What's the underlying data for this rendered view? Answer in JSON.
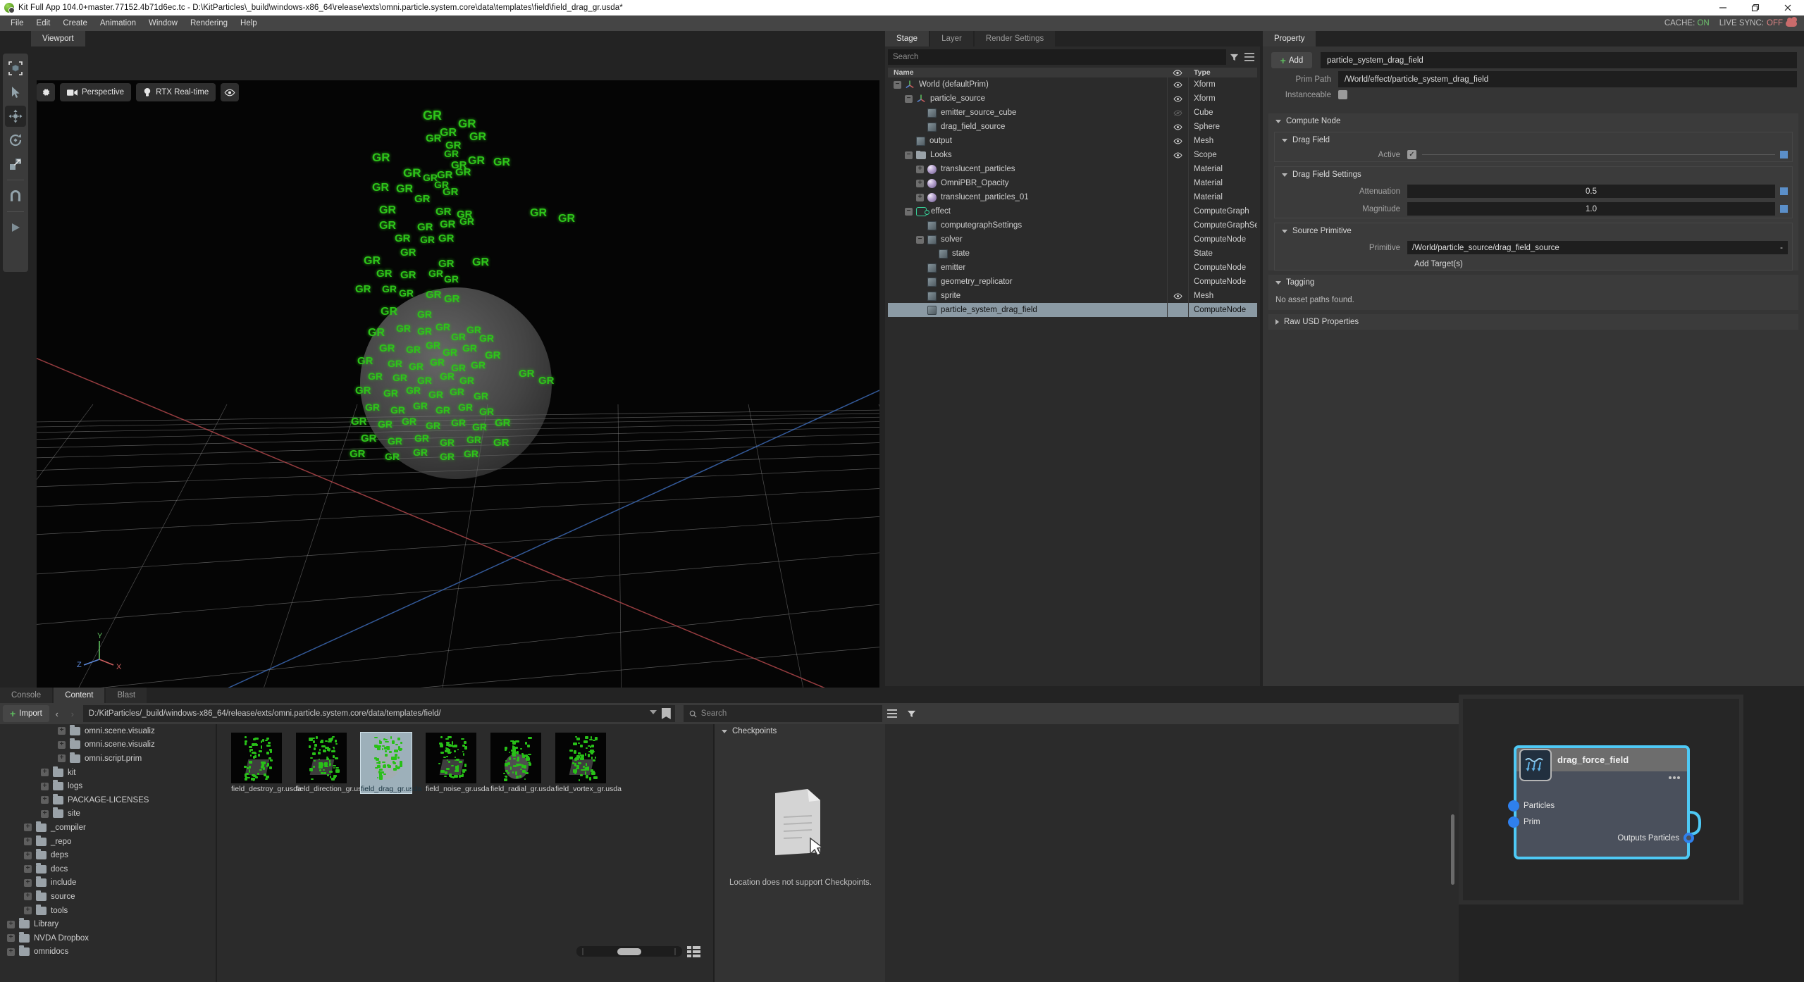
{
  "titlebar": {
    "title": "Kit Full App 104.0+master.77152.4b71d6ec.tc - D:\\KitParticles\\_build\\windows-x86_64\\release\\exts\\omni.particle.system.core\\data\\templates\\field\\field_drag_gr.usda*",
    "minimize": "minimize-icon",
    "maximize": "maximize-icon",
    "close": "close-icon"
  },
  "menubar": {
    "items": [
      "File",
      "Edit",
      "Create",
      "Animation",
      "Window",
      "Rendering",
      "Help"
    ],
    "cache_label": "CACHE:",
    "cache_value": "ON",
    "livesync_label": "LIVE SYNC:",
    "livesync_value": "OFF"
  },
  "viewport": {
    "tab": "Viewport",
    "toolbar": {
      "settings": "gear-icon",
      "camera": "Perspective",
      "renderer": "RTX Real-time",
      "visibility": "eye-icon"
    },
    "left_tools": [
      "select-bounds-tool",
      "pointer-select-tool",
      "move-tool",
      "rotate-tool",
      "scale-tool",
      "snap-tool",
      "play-tool"
    ],
    "axis": {
      "x": "X",
      "y": "Y",
      "z": "Z"
    },
    "particle_label": "GR"
  },
  "stage": {
    "tabs": [
      {
        "label": "Stage",
        "active": true
      },
      {
        "label": "Layer",
        "active": false
      },
      {
        "label": "Render Settings",
        "active": false
      }
    ],
    "search_placeholder": "Search",
    "columns": {
      "name": "Name",
      "eye": "eye-icon",
      "type": "Type"
    },
    "rows": [
      {
        "name": "World (defaultPrim)",
        "type": "Xform",
        "depth": 0,
        "icon": "xform",
        "expander": "minus",
        "eye": true
      },
      {
        "name": "particle_source",
        "type": "Xform",
        "depth": 1,
        "icon": "xform",
        "expander": "minus",
        "eye": true
      },
      {
        "name": "emitter_source_cube",
        "type": "Cube",
        "depth": 2,
        "icon": "cube",
        "expander": "none",
        "eye": "dim"
      },
      {
        "name": "drag_field_source",
        "type": "Sphere",
        "depth": 2,
        "icon": "cube",
        "expander": "none",
        "eye": true
      },
      {
        "name": "output",
        "type": "Mesh",
        "depth": 1,
        "icon": "cube",
        "expander": "none",
        "eye": true
      },
      {
        "name": "Looks",
        "type": "Scope",
        "depth": 1,
        "icon": "folder",
        "expander": "minus",
        "eye": true
      },
      {
        "name": "translucent_particles",
        "type": "Material",
        "depth": 2,
        "icon": "mat",
        "expander": "plus",
        "eye": false
      },
      {
        "name": "OmniPBR_Opacity",
        "type": "Material",
        "depth": 2,
        "icon": "mat",
        "expander": "plus",
        "eye": false
      },
      {
        "name": "translucent_particles_01",
        "type": "Material",
        "depth": 2,
        "icon": "mat",
        "expander": "plus",
        "eye": false
      },
      {
        "name": "effect",
        "type": "ComputeGraph",
        "depth": 1,
        "icon": "graph",
        "expander": "minus",
        "eye": false
      },
      {
        "name": "computegraphSettings",
        "type": "ComputeGraphSe",
        "depth": 2,
        "icon": "cube",
        "expander": "none",
        "eye": false
      },
      {
        "name": "solver",
        "type": "ComputeNode",
        "depth": 2,
        "icon": "cube",
        "expander": "minus",
        "eye": false
      },
      {
        "name": "state",
        "type": "State",
        "depth": 3,
        "icon": "cube",
        "expander": "none",
        "eye": false
      },
      {
        "name": "emitter",
        "type": "ComputeNode",
        "depth": 2,
        "icon": "cube",
        "expander": "none",
        "eye": false
      },
      {
        "name": "geometry_replicator",
        "type": "ComputeNode",
        "depth": 2,
        "icon": "cube",
        "expander": "none",
        "eye": false
      },
      {
        "name": "sprite",
        "type": "Mesh",
        "depth": 2,
        "icon": "cube",
        "expander": "none",
        "eye": true
      },
      {
        "name": "particle_system_drag_field",
        "type": "ComputeNode",
        "depth": 2,
        "icon": "cube",
        "expander": "none",
        "eye": false,
        "selected": true
      }
    ]
  },
  "property": {
    "tab": "Property",
    "add_label": "Add",
    "name_value": "particle_system_drag_field",
    "prim_path_label": "Prim Path",
    "prim_path_value": "/World/effect/particle_system_drag_field",
    "instanceable_label": "Instanceable",
    "compute_node_label": "Compute Node",
    "drag_field_label": "Drag Field",
    "active_label": "Active",
    "drag_field_settings_label": "Drag Field Settings",
    "attenuation_label": "Attenuation",
    "attenuation_value": "0.5",
    "magnitude_label": "Magnitude",
    "magnitude_value": "1.0",
    "source_primitive_label": "Source Primitive",
    "primitive_label": "Primitive",
    "primitive_value": "/World/particle_source/drag_field_source",
    "primitive_clear": "-",
    "add_targets_label": "Add Target(s)",
    "tagging_label": "Tagging",
    "no_asset_label": "No asset paths found.",
    "raw_usd_label": "Raw USD Properties"
  },
  "content": {
    "tabs": [
      {
        "label": "Console",
        "active": false
      },
      {
        "label": "Content",
        "active": true
      },
      {
        "label": "Blast",
        "active": false
      }
    ],
    "import_label": "Import",
    "path_value": "D:/KitParticles/_build/windows-x86_64/release/exts/omni.particle.system.core/data/templates/field/",
    "search_placeholder": "Search",
    "tree": [
      {
        "label": "omni.scene.visualiz",
        "depth": 3,
        "clipped": true
      },
      {
        "label": "omni.scene.visualiz",
        "depth": 3
      },
      {
        "label": "omni.script.prim",
        "depth": 3
      },
      {
        "label": "kit",
        "depth": 2
      },
      {
        "label": "logs",
        "depth": 2
      },
      {
        "label": "PACKAGE-LICENSES",
        "depth": 2
      },
      {
        "label": "site",
        "depth": 2
      },
      {
        "label": "_compiler",
        "depth": 1
      },
      {
        "label": "_repo",
        "depth": 1
      },
      {
        "label": "deps",
        "depth": 1
      },
      {
        "label": "docs",
        "depth": 1
      },
      {
        "label": "include",
        "depth": 1
      },
      {
        "label": "source",
        "depth": 1
      },
      {
        "label": "tools",
        "depth": 1
      },
      {
        "label": "Library",
        "depth": 0
      },
      {
        "label": "NVDA Dropbox",
        "depth": 0
      },
      {
        "label": "omnidocs",
        "depth": 0
      }
    ],
    "files": [
      {
        "name": "field_destroy_gr.usda",
        "selected": false,
        "sphere": false
      },
      {
        "name": "field_direction_gr.usda",
        "selected": false,
        "sphere": false
      },
      {
        "name": "field_drag_gr.usda",
        "selected": true,
        "sphere": true
      },
      {
        "name": "field_noise_gr.usda",
        "selected": false,
        "sphere": false
      },
      {
        "name": "field_radial_gr.usda",
        "selected": false,
        "sphere": true
      },
      {
        "name": "field_vortex_gr.usda",
        "selected": false,
        "sphere": false
      }
    ],
    "checkpoints_label": "Checkpoints",
    "checkpoints_message": "Location does not support Checkpoints."
  },
  "graph": {
    "node_title": "drag_force_field",
    "inputs": [
      "Particles",
      "Prim"
    ],
    "output": "Outputs Particles",
    "badge": "drag-force-icon",
    "accent_color": "#4ec9f5"
  }
}
